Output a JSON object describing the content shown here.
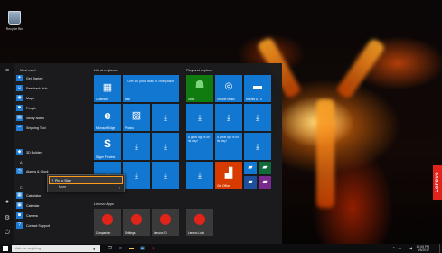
{
  "desktop": {
    "recycle_bin_label": "Recycle Bin",
    "oem_badge": "Lenovo"
  },
  "rail_icons": [
    "hamburger-icon",
    "user-icon",
    "settings-icon",
    "power-icon"
  ],
  "app_list": {
    "most_used_header": "Most used",
    "items": [
      {
        "label": "Get Started",
        "icon": "lightbulb-icon",
        "color": "#1f7ad3"
      },
      {
        "label": "Feedback Hub",
        "icon": "feedback-icon",
        "color": "#1f7ad3"
      },
      {
        "label": "Maps",
        "icon": "maps-icon",
        "color": "#1f7ad3"
      },
      {
        "label": "People",
        "icon": "people-icon",
        "color": "#1f7ad3"
      },
      {
        "label": "Sticky Notes",
        "icon": "sticky-notes-icon",
        "color": "#1f7ad3"
      },
      {
        "label": "Snipping Tool",
        "icon": "scissors-icon",
        "color": "#1f7ad3"
      }
    ],
    "recent_label": "3D Builder",
    "section_a_header": "A",
    "section_a_item": "Alarms & Clock",
    "section_c_header": "C",
    "c_items": [
      "Calculator",
      "Calendar",
      "Camera",
      "Contact Support"
    ]
  },
  "context_menu": {
    "pin_label": "Pin to Start",
    "more_label": "More"
  },
  "tiles": {
    "group1_header": "Life at a glance",
    "group2_header": "Play and explore",
    "group3_header": "Lenovo Apps",
    "calendar_label": "Calendar",
    "mail_label": "Mail",
    "mail_text": "Get all your mail in one place",
    "edge_label": "Microsoft Edge",
    "photos_label": "Photos",
    "skype_label": "Skype Preview",
    "great_app_text": "A great app is on its way!",
    "xbox_label": "Xbox",
    "groove_label": "Groove Music",
    "movies_label": "Movies & TV",
    "office_label": "Get Office",
    "companion_label": "Companion",
    "settings_label": "Settings",
    "lenovo_id_label": "Lenovo ID",
    "lock_label": "Lenovo Lock"
  },
  "taskbar": {
    "search_placeholder": "Ask me anything",
    "time": "10:05 PM",
    "date": "6/5/2017"
  },
  "colors": {
    "tile_blue": "#1277d0",
    "tile_green": "#107c10",
    "office_red": "#d83b01",
    "lenovo_red": "#e2231a",
    "highlight_orange": "#ff9a1a"
  }
}
